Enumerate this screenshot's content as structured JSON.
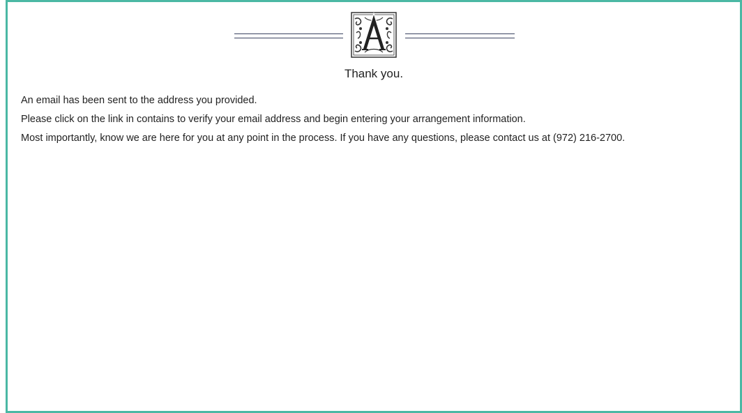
{
  "page": {
    "border_color": "#4bb8a4",
    "monogram_letter": "A",
    "title": "Thank you.",
    "messages": [
      "An email has been sent to the address you provided.",
      "Please click on the link in contains to verify your email address and begin entering your arrangement information.",
      "Most importantly, know we are here for you at any point in the process. If you have any questions, please contact us at (972) 216-2700."
    ]
  }
}
